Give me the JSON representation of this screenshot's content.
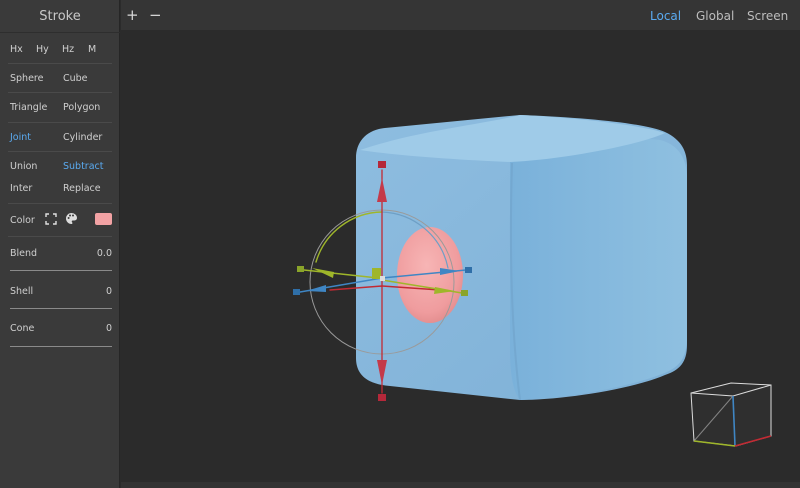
{
  "panel": {
    "title": "Stroke",
    "axes": [
      "Hx",
      "Hy",
      "Hz",
      "M"
    ],
    "shapes": [
      [
        "Sphere",
        "Cube"
      ],
      [
        "Triangle",
        "Polygon"
      ],
      [
        "Joint",
        "Cylinder"
      ]
    ],
    "ops": [
      [
        "Union",
        "Subtract"
      ],
      [
        "Inter",
        "Replace"
      ]
    ],
    "active_shape": "Joint",
    "active_op": "Subtract",
    "color_label": "Color",
    "color_swatch": "#f2a2a4",
    "params": [
      {
        "label": "Blend",
        "value": "0.0"
      },
      {
        "label": "Shell",
        "value": "0"
      },
      {
        "label": "Cone",
        "value": "0"
      }
    ]
  },
  "toolbar": {
    "add": "+",
    "remove": "−",
    "spaces": [
      "Local",
      "Global",
      "Screen"
    ],
    "active_space": "Local"
  },
  "colors": {
    "accent": "#5aaaf0",
    "cube": "#8fbfdf",
    "sphere": "#f0a0a0"
  },
  "icons": [
    "fit-icon",
    "palette-icon"
  ]
}
